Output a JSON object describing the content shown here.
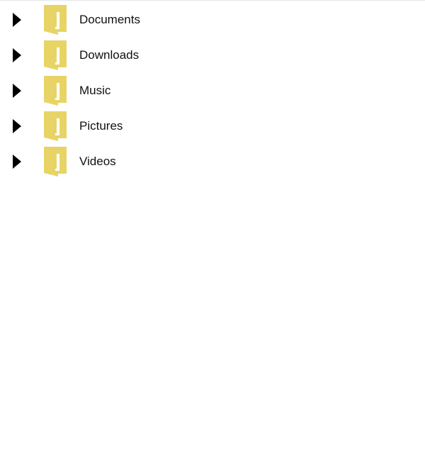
{
  "tree": {
    "items": [
      {
        "label": "Documents",
        "icon": "folder-icon",
        "expander_icon": "chevron-right-icon",
        "expanded": false
      },
      {
        "label": "Downloads",
        "icon": "folder-icon",
        "expander_icon": "chevron-right-icon",
        "expanded": false
      },
      {
        "label": "Music",
        "icon": "folder-icon",
        "expander_icon": "chevron-right-icon",
        "expanded": false
      },
      {
        "label": "Pictures",
        "icon": "folder-icon",
        "expander_icon": "chevron-right-icon",
        "expanded": false
      },
      {
        "label": "Videos",
        "icon": "folder-icon",
        "expander_icon": "chevron-right-icon",
        "expanded": false
      }
    ]
  },
  "colors": {
    "folder_fill": "#E8D466",
    "folder_inner": "#ffffff",
    "expander": "#000000",
    "text": "#111111",
    "background": "#ffffff"
  }
}
